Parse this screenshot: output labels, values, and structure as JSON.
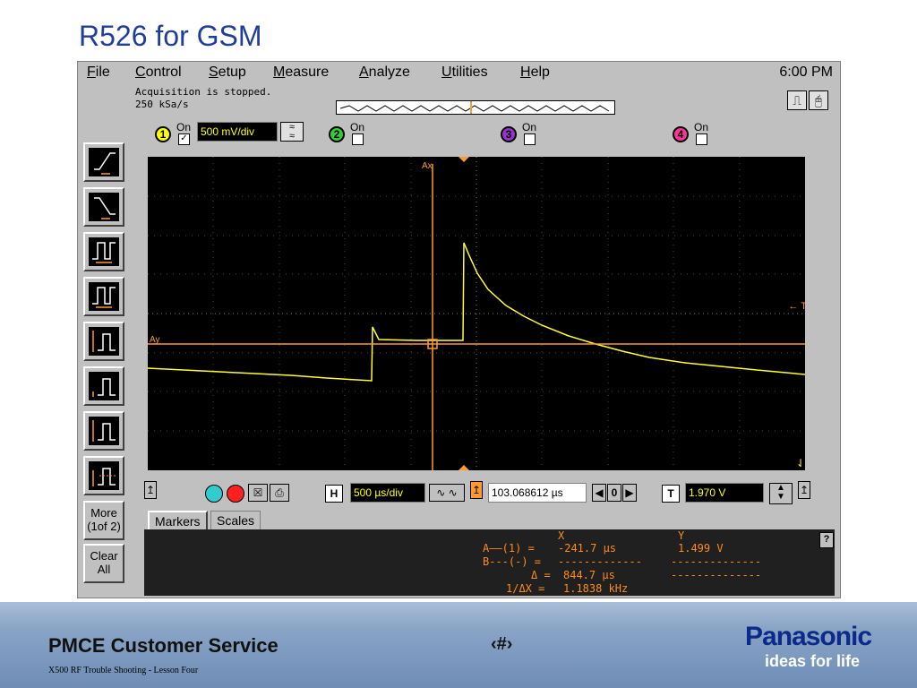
{
  "slide": {
    "title": "R526 for GSM"
  },
  "menu": {
    "items": [
      "File",
      "Control",
      "Setup",
      "Measure",
      "Analyze",
      "Utilities",
      "Help"
    ],
    "clock": "6:00 PM"
  },
  "status": {
    "line1": "Acquisition is stopped.",
    "line2": "250 kSa/s"
  },
  "channels": [
    {
      "num": "1",
      "on_label": "On",
      "checked": true,
      "scale": "500 mV/div",
      "color": "#ffff00"
    },
    {
      "num": "2",
      "on_label": "On",
      "checked": false,
      "color": "#33cc33"
    },
    {
      "num": "3",
      "on_label": "On",
      "checked": false,
      "color": "#9933cc"
    },
    {
      "num": "4",
      "on_label": "On",
      "checked": false,
      "color": "#ff3399"
    }
  ],
  "left_buttons": {
    "more": "More\n(1of 2)",
    "more_line1": "More",
    "more_line2": "(1of 2)",
    "clear_line1": "Clear",
    "clear_line2": "All"
  },
  "graticule": {
    "ax_label": "Ax",
    "ay_label": "Ay",
    "trigger_label": "← T",
    "trace_color": "#ffff33",
    "marker_color": "#ff9a2e"
  },
  "timebase": {
    "h_label": "H",
    "scale": "500 µs/div",
    "delay": "103.068612 µs",
    "delay_value": "0",
    "t_label": "T",
    "trigger_level": "1.970 V"
  },
  "tabs": [
    "Markers",
    "Scales"
  ],
  "markers": {
    "x_header": "X",
    "y_header": "Y",
    "rows": [
      {
        "label": "A——(1) =",
        "x": "-241.7 µs",
        "y": "1.499 V"
      },
      {
        "label": "B---(-) =",
        "x": "-------------",
        "y": "--------------"
      },
      {
        "label": "Δ =",
        "x": "844.7 µs",
        "y": "--------------"
      },
      {
        "label": "1/ΔX =",
        "x": "1.1838 kHz",
        "y": ""
      }
    ],
    "help": "?"
  },
  "footer": {
    "service": "PMCE Customer Service",
    "subtitle": "X500 RF Trouble Shooting  -  Lesson Four",
    "page": "‹#›",
    "brand": "Panasonic",
    "tagline": "ideas for life"
  }
}
